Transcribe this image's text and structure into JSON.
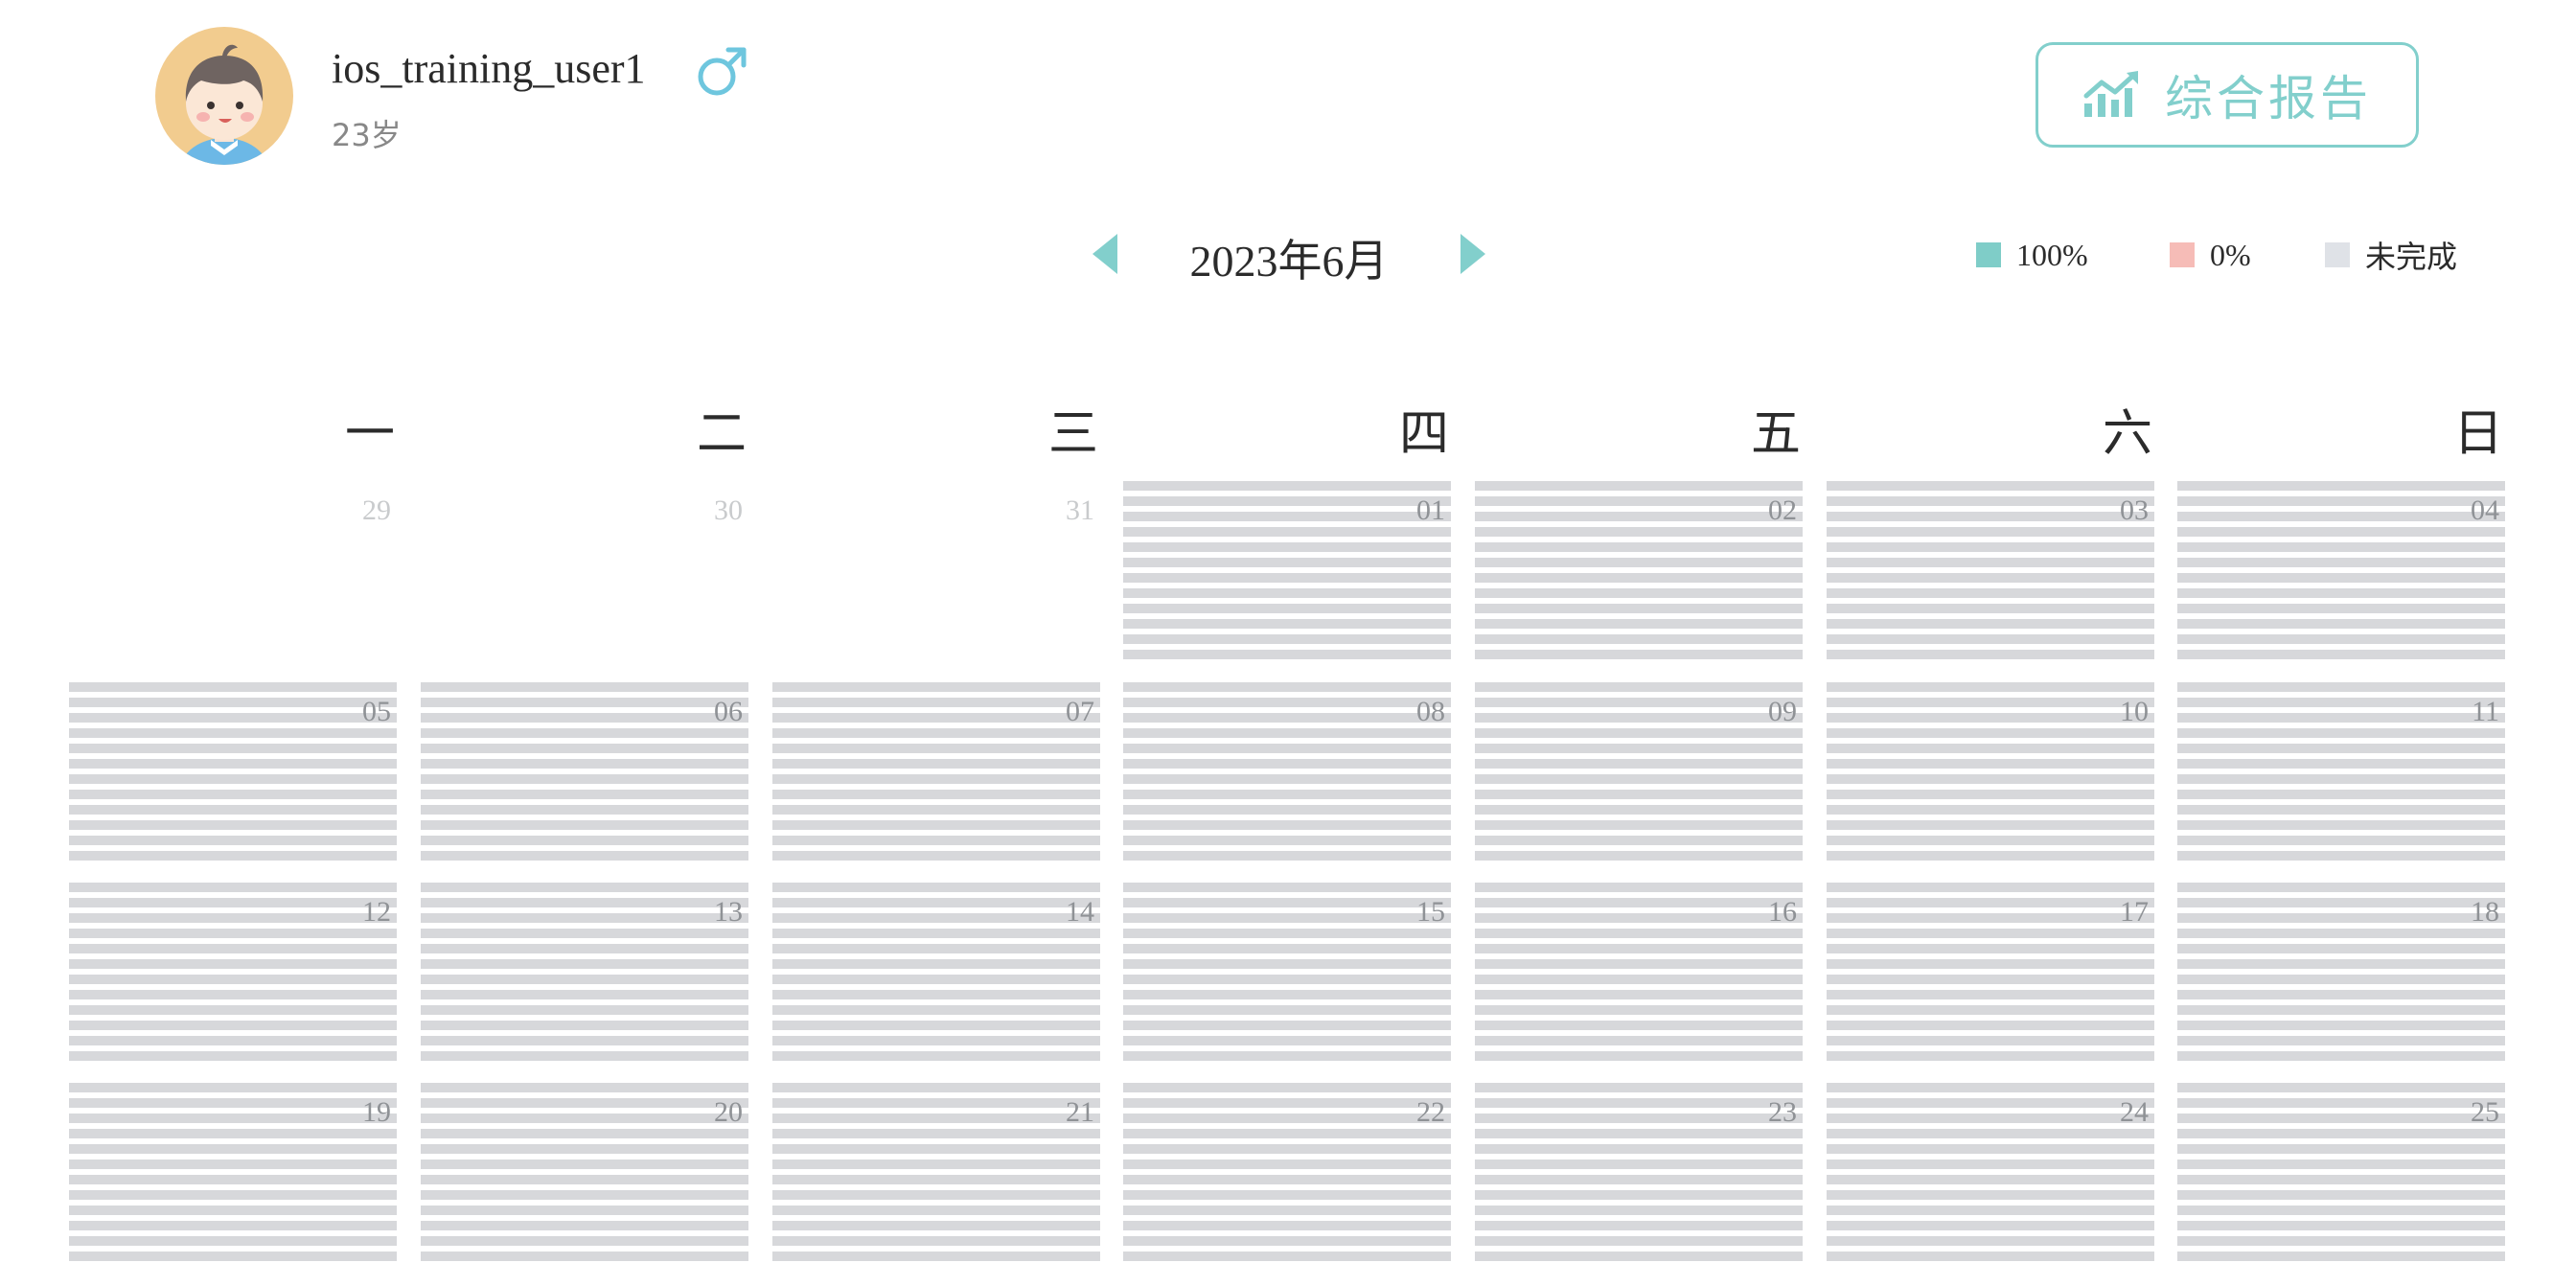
{
  "user": {
    "name": "ios_training_user1",
    "age": "23岁",
    "gender_icon": "male-symbol-icon",
    "avatar_icon": "boy-avatar-icon"
  },
  "report_button": {
    "label": "综合报告",
    "icon": "trend-chart-icon"
  },
  "calendar": {
    "month_title": "2023年6月",
    "prev_icon": "triangle-left-icon",
    "next_icon": "triangle-right-icon",
    "weekdays": [
      "一",
      "二",
      "三",
      "四",
      "五",
      "六",
      "日"
    ],
    "weeks": [
      [
        {
          "day": "29",
          "current": false
        },
        {
          "day": "30",
          "current": false
        },
        {
          "day": "31",
          "current": false
        },
        {
          "day": "01",
          "current": true
        },
        {
          "day": "02",
          "current": true
        },
        {
          "day": "03",
          "current": true
        },
        {
          "day": "04",
          "current": true
        }
      ],
      [
        {
          "day": "05",
          "current": true
        },
        {
          "day": "06",
          "current": true
        },
        {
          "day": "07",
          "current": true
        },
        {
          "day": "08",
          "current": true
        },
        {
          "day": "09",
          "current": true
        },
        {
          "day": "10",
          "current": true
        },
        {
          "day": "11",
          "current": true
        }
      ],
      [
        {
          "day": "12",
          "current": true
        },
        {
          "day": "13",
          "current": true
        },
        {
          "day": "14",
          "current": true
        },
        {
          "day": "15",
          "current": true
        },
        {
          "day": "16",
          "current": true
        },
        {
          "day": "17",
          "current": true
        },
        {
          "day": "18",
          "current": true
        }
      ],
      [
        {
          "day": "19",
          "current": true
        },
        {
          "day": "20",
          "current": true
        },
        {
          "day": "21",
          "current": true
        },
        {
          "day": "22",
          "current": true
        },
        {
          "day": "23",
          "current": true
        },
        {
          "day": "24",
          "current": true
        },
        {
          "day": "25",
          "current": true
        }
      ]
    ]
  },
  "legend": [
    {
      "label": "100%",
      "color": "#7fcdc8"
    },
    {
      "label": "0%",
      "color": "#f6bcb7"
    },
    {
      "label": "未完成",
      "color": "#dfe2e7"
    }
  ],
  "colors": {
    "accent": "#82cfcc",
    "incomplete_stripe": "#d7d8db"
  }
}
